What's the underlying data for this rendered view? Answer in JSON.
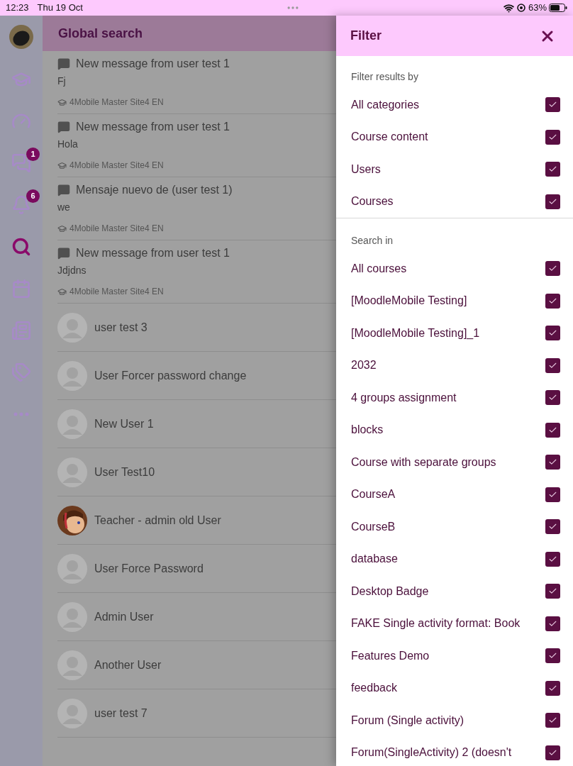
{
  "status_bar": {
    "time": "12:23",
    "date": "Thu 19 Oct",
    "battery": "63%"
  },
  "sidebar": {
    "items": [
      {
        "kind": "avatar",
        "selected": false
      },
      {
        "kind": "courses",
        "selected": false
      },
      {
        "kind": "dashboard",
        "selected": false
      },
      {
        "kind": "messages",
        "selected": false,
        "badge": "1"
      },
      {
        "kind": "notifications",
        "selected": false,
        "badge": "6"
      },
      {
        "kind": "search",
        "selected": true
      },
      {
        "kind": "calendar",
        "selected": false
      },
      {
        "kind": "news",
        "selected": false
      },
      {
        "kind": "tags",
        "selected": false
      },
      {
        "kind": "more",
        "selected": false
      }
    ]
  },
  "page": {
    "title": "Global search"
  },
  "results": [
    {
      "kind": "message",
      "title": "New message from user test 1",
      "body": "Fj",
      "site": "4Mobile Master Site4 EN"
    },
    {
      "kind": "message",
      "title": "New message from user test 1",
      "body": "Hola",
      "site": "4Mobile Master Site4 EN"
    },
    {
      "kind": "message",
      "title": "Mensaje nuevo de (user test 1)",
      "body": "we",
      "site": "4Mobile Master Site4 EN"
    },
    {
      "kind": "message",
      "title": "New message from user test 1",
      "body": "Jdjdns",
      "site": "4Mobile Master Site4 EN"
    },
    {
      "kind": "user",
      "name": "user test 3"
    },
    {
      "kind": "user",
      "name": "User Forcer password change"
    },
    {
      "kind": "user",
      "name": "New User 1"
    },
    {
      "kind": "user",
      "name": "User Test10"
    },
    {
      "kind": "user",
      "name": "Teacher - admin old User",
      "photo": true
    },
    {
      "kind": "user",
      "name": "User Force Password"
    },
    {
      "kind": "user",
      "name": "Admin User"
    },
    {
      "kind": "user",
      "name": "Another User"
    },
    {
      "kind": "user",
      "name": "user test 7"
    }
  ],
  "filter": {
    "title": "Filter",
    "sections": [
      {
        "heading": "Filter results by",
        "options": [
          {
            "label": "All categories",
            "checked": true
          },
          {
            "label": "Course content",
            "checked": true
          },
          {
            "label": "Users",
            "checked": true
          },
          {
            "label": "Courses",
            "checked": true
          }
        ]
      },
      {
        "heading": "Search in",
        "options": [
          {
            "label": "All courses",
            "checked": true
          },
          {
            "label": "[MoodleMobile Testing]",
            "checked": true
          },
          {
            "label": "[MoodleMobile Testing]_1",
            "checked": true
          },
          {
            "label": "2032",
            "checked": true
          },
          {
            "label": "4 groups assignment",
            "checked": true
          },
          {
            "label": "blocks",
            "checked": true
          },
          {
            "label": "Course with separate groups",
            "checked": true
          },
          {
            "label": "CourseA",
            "checked": true
          },
          {
            "label": "CourseB",
            "checked": true
          },
          {
            "label": "database",
            "checked": true
          },
          {
            "label": "Desktop Badge",
            "checked": true
          },
          {
            "label": "FAKE Single activity format: Book",
            "checked": true
          },
          {
            "label": "Features Demo",
            "checked": true
          },
          {
            "label": "feedback",
            "checked": true
          },
          {
            "label": "Forum (Single activity)",
            "checked": true
          },
          {
            "label": "Forum(SingleActivity) 2 (doesn't",
            "checked": true
          }
        ]
      }
    ]
  }
}
